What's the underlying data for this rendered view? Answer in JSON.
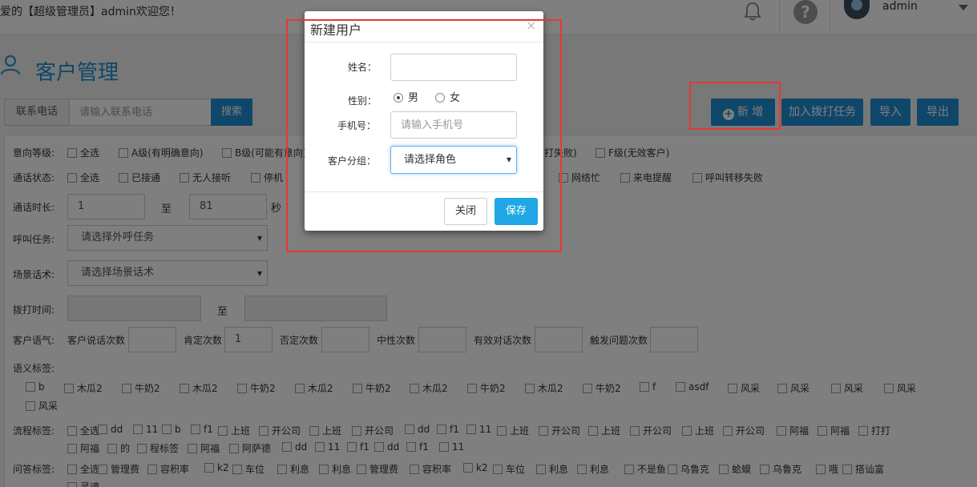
{
  "topbar": {
    "welcome": "爱的【超级管理员】admin欢迎您！",
    "username": "admin",
    "icons": [
      "bell-icon",
      "help-icon",
      "avatar",
      "caret-down-icon"
    ]
  },
  "page": {
    "title": "客户管理",
    "search_label": "联系电话",
    "search_placeholder": "请输入联系电话",
    "search_button": "搜索",
    "actions": {
      "add": "新 增",
      "add_call_task": "加入拨打任务",
      "import": "导入",
      "export": "导出"
    }
  },
  "filters": {
    "intent_label": "意向等级:",
    "intent_items": [
      "全选",
      "A级(有明确意向)",
      "B级(可能有意向)",
      "打失败)",
      "F级(无效客户)"
    ],
    "call_status_label": "通话状态:",
    "call_status_items": [
      "全选",
      "已接通",
      "无人接听",
      "停机",
      "网络忙",
      "来电提醒",
      "呼叫转移失败"
    ],
    "duration_label": "通话时长:",
    "duration_from": "1",
    "duration_to_label": "至",
    "duration_to": "81",
    "duration_unit": "秒",
    "task_label": "呼叫任务:",
    "task_placeholder": "请选择外呼任务",
    "script_label": "场景话术:",
    "script_placeholder": "请选择场景话术",
    "dial_time_label": "拨打时间:",
    "dial_time_to": "至",
    "tone_label": "客户语气:",
    "tone_items": [
      "客户说话次数",
      "肯定次数",
      "否定次数",
      "中性次数",
      "有效对话次数",
      "触发问题次数"
    ],
    "tone_affirm_value": "1",
    "semantic_label": "语义标签:",
    "semantic_items_row1": [
      "b",
      "木瓜2",
      "牛奶2",
      "木瓜2",
      "牛奶2",
      "木瓜2",
      "牛奶2",
      "木瓜2",
      "牛奶2",
      "木瓜2",
      "牛奶2",
      "f",
      "asdf",
      "风采",
      "风采",
      "风采",
      "风采"
    ],
    "semantic_items_row2": [
      "风采"
    ],
    "flow_label": "流程标签:",
    "flow_items_row1": [
      "全选",
      "dd",
      "11",
      "b",
      "f1",
      "上班",
      "开公司",
      "上班",
      "开公司",
      "dd",
      "f1",
      "11",
      "上班",
      "开公司",
      "上班",
      "开公司",
      "上班",
      "开公司",
      "阿福",
      "阿福",
      "打打"
    ],
    "flow_items_row2": [
      "阿福",
      "的",
      "程标签",
      "阿福",
      "阿萨德",
      "dd",
      "11",
      "f1",
      "dd",
      "f1",
      "11"
    ],
    "qa_label": "问答标签:",
    "qa_items_row1": [
      "全选",
      "管理费",
      "容积率",
      "k2",
      "车位",
      "利息",
      "利息",
      "管理费",
      "容积率",
      "k2",
      "车位",
      "利息",
      "利息",
      "不是鱼",
      "乌鲁克",
      "蛤蟆",
      "乌鲁克",
      "哦",
      "搭讪富"
    ],
    "qa_items_row2": [
      "灵魂"
    ]
  },
  "modal": {
    "title": "新建用户",
    "close_x": "×",
    "name_label": "姓名：",
    "name_value": "",
    "gender_label": "性别：",
    "gender_male": "男",
    "gender_female": "女",
    "gender_selected": "男",
    "phone_label": "手机号：",
    "phone_placeholder": "请输入手机号",
    "group_label": "客户分组：",
    "group_placeholder": "请选择角色",
    "close_button": "关闭",
    "save_button": "保存"
  },
  "colors": {
    "primary": "#1e8fd6",
    "save": "#1ea7e4",
    "highlight_box": "#e53935",
    "overlay": "rgba(0,0,0,0.5)"
  }
}
